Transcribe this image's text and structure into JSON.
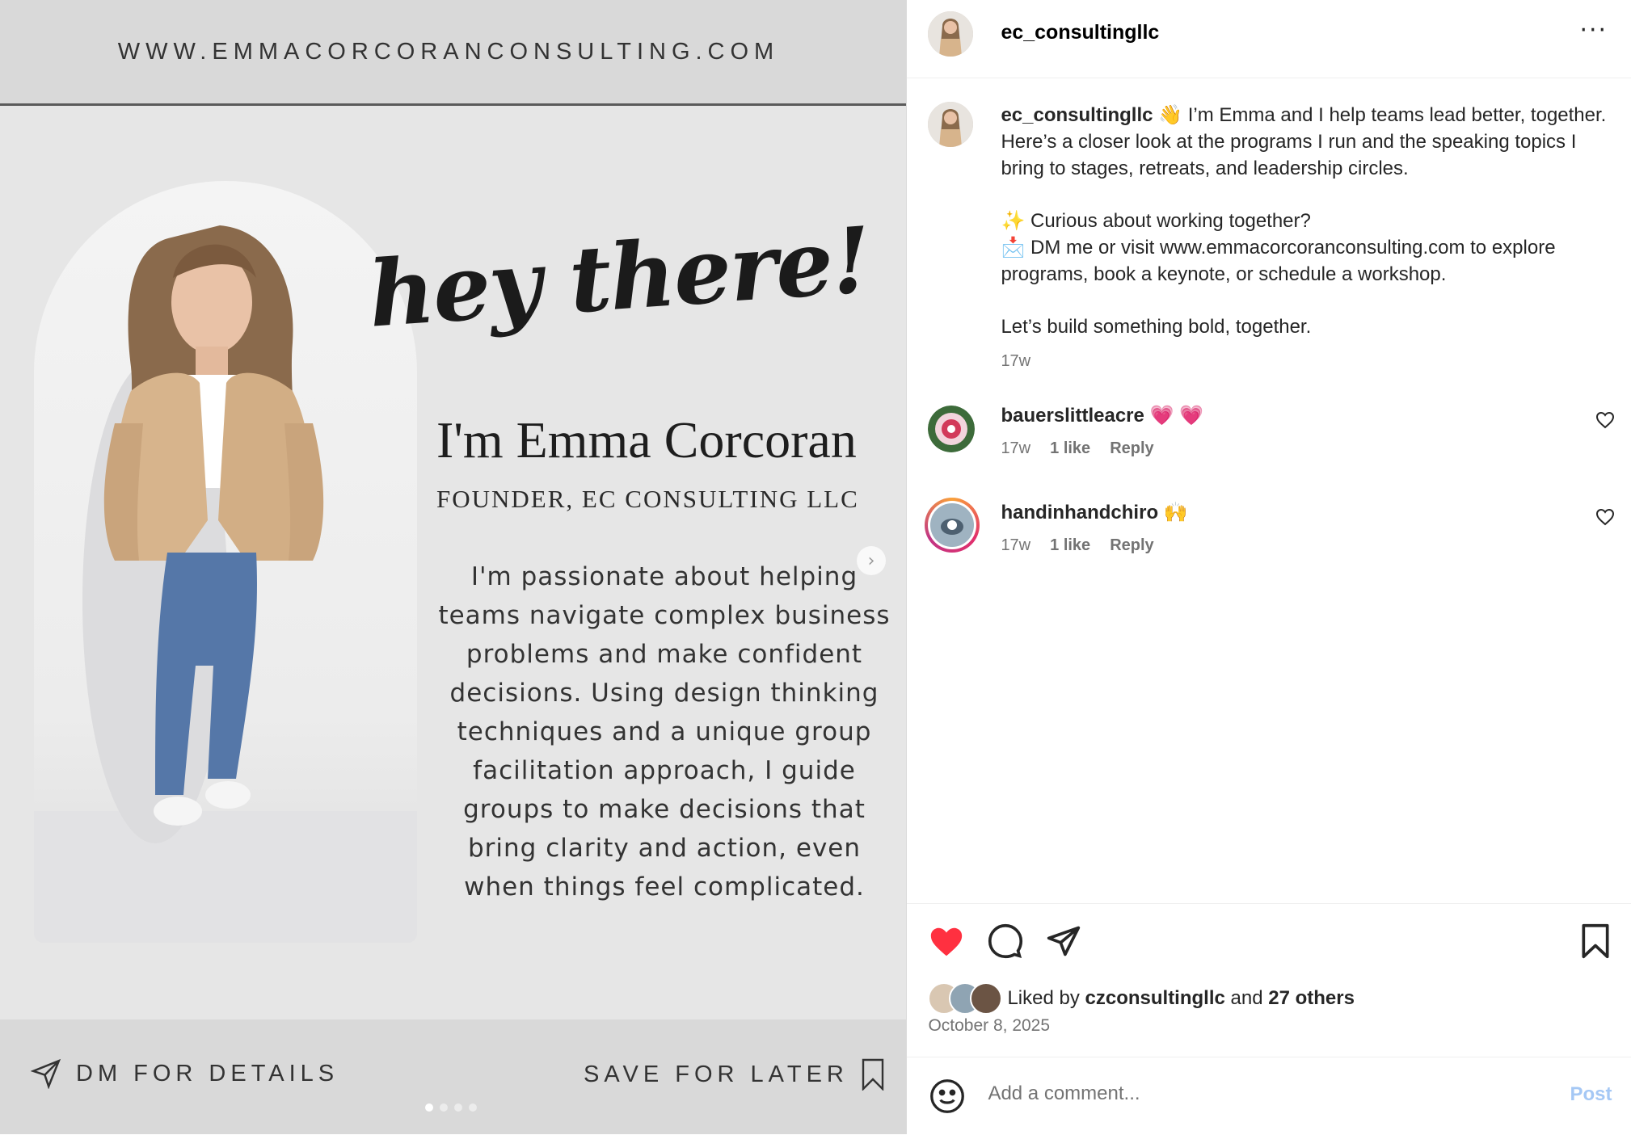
{
  "post_image": {
    "website": "WWW.EMMACORCORANCONSULTING.COM",
    "greeting": "hey there!",
    "name": "I'm Emma Corcoran",
    "role": "FOUNDER, EC CONSULTING LLC",
    "bio": "I'm passionate about helping teams navigate complex business problems and make confident decisions. Using design thinking techniques and a unique group facilitation approach, I guide groups to make decisions that bring clarity and action, even when things feel complicated.",
    "cta_left": "DM FOR DETAILS",
    "cta_right": "SAVE FOR LATER",
    "carousel_total": 4,
    "carousel_active": 1
  },
  "header": {
    "username": "ec_consultingllc",
    "more_label": "···"
  },
  "caption": {
    "username": "ec_consultingllc",
    "line1": "👋 I’m Emma and I help teams lead better, together. Here’s a closer look at the programs I run and the speaking topics I bring to stages, retreats, and leadership circles.",
    "line2": "✨ Curious about working together?",
    "line3": "📩 DM me or visit www.emmacorcoranconsulting.com to explore programs, book a keynote, or schedule a workshop.",
    "line4": "Let’s build something bold, together.",
    "time": "17w"
  },
  "comments": [
    {
      "username": "bauerslittleacre",
      "text": "💗 💗",
      "time": "17w",
      "likes": "1 like",
      "reply": "Reply"
    },
    {
      "username": "handinhandchiro",
      "text": "🙌",
      "time": "17w",
      "likes": "1 like",
      "reply": "Reply"
    }
  ],
  "likes": {
    "prefix": "Liked by",
    "user": "czconsultingllc",
    "and": "and",
    "others": "27 others"
  },
  "date": "October 8, 2025",
  "add_comment": {
    "placeholder": "Add a comment...",
    "post_label": "Post"
  },
  "colors": {
    "heart": "#ff3040",
    "post_button": "#a5c8f5",
    "muted": "#737373"
  },
  "icons": [
    "heart-icon",
    "comment-icon",
    "share-icon",
    "bookmark-icon",
    "emoji-icon",
    "send-icon",
    "chevron-right-icon"
  ]
}
